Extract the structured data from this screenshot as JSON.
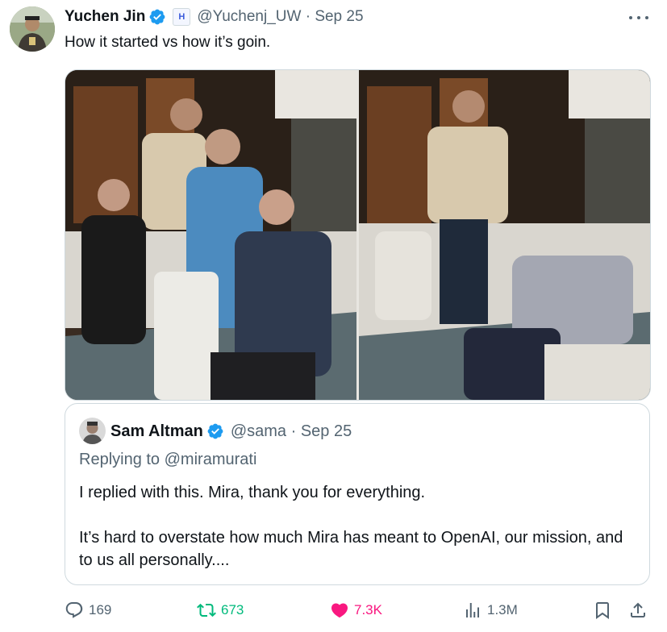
{
  "tweet": {
    "author_name": "Yuchen Jin",
    "affiliation_badge": "H",
    "handle_date": "@Yuchenj_UW · Sep 25",
    "text": "How it started vs how it’s goin."
  },
  "quote": {
    "author_name": "Sam Altman",
    "handle_date": "@sama · Sep 25",
    "replying_prefix": "Replying to",
    "replying_mention": "@miramurati",
    "paragraph_1": "I replied with this. Mira, thank you for everything.",
    "paragraph_2": "It’s hard to overstate how much Mira has meant to OpenAI, our mission, and to us all personally...."
  },
  "actions": {
    "replies": "169",
    "retweets": "673",
    "likes": "7.3K",
    "views": "1.3M"
  },
  "colors": {
    "verified": "#1d9bf0",
    "retweet": "#00ba7c",
    "like": "#f91880",
    "secondary_text": "#536471"
  },
  "icons": [
    "verified-icon",
    "more-icon",
    "reply-icon",
    "retweet-icon",
    "like-icon",
    "views-icon",
    "bookmark-icon",
    "share-icon"
  ]
}
